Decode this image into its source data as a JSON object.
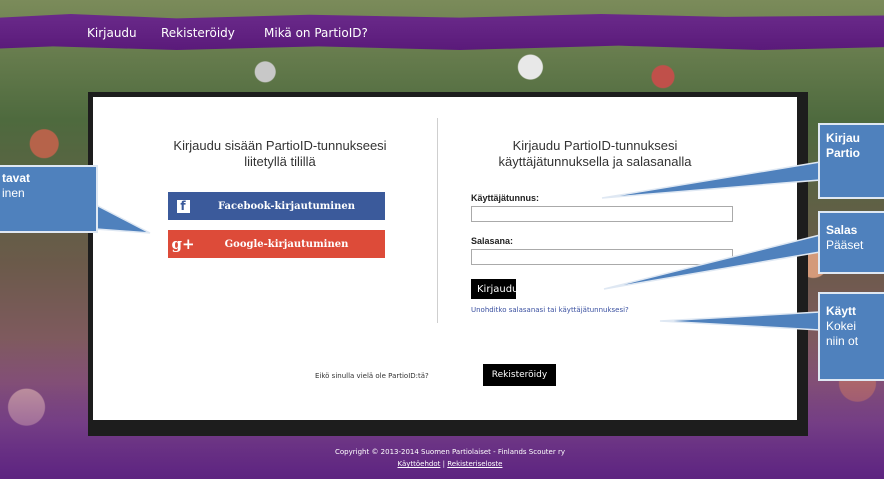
{
  "nav": {
    "items": [
      "Kirjaudu",
      "Rekisteröidy",
      "Mikä on PartioID?"
    ]
  },
  "left": {
    "title_line1": "Kirjaudu sisään PartioID-tunnukseesi",
    "title_line2": "liitetyllä tilillä",
    "facebook_label": "Facebook-kirjautuminen",
    "facebook_icon": "f",
    "google_label": "Google-kirjautuminen",
    "google_icon": "g+"
  },
  "right": {
    "title_line1": "Kirjaudu PartioID-tunnuksesi",
    "title_line2": "käyttäjätunnuksella ja salasanalla",
    "username_label": "Käyttäjätunnus:",
    "username_value": "",
    "password_label": "Salasana:",
    "password_value": "",
    "login_button": "Kirjaudu",
    "forgot_link": "Unohditko salasanasi tai käyttäjätunnuksesi?"
  },
  "register": {
    "prompt": "Eikö sinulla vielä ole PartioID:tä?",
    "button": "Rekisteröidy"
  },
  "footer": {
    "copyright": "Copyright © 2013-2014 Suomen Partiolaiset - Finlands Scouter ry",
    "terms_link": "Käyttöehdot",
    "separator": "|",
    "privacy_link": "Rekisteriseloste"
  },
  "callouts": {
    "left_line1": "tavat",
    "left_line2": "inen",
    "right1_line1": "Kirjau",
    "right1_line2": "Partio",
    "right2_line1": "Salas",
    "right2_line2": "Pääset",
    "right3_line1": "Käytt",
    "right3_line2": "Kokei",
    "right3_line3": "niin ot"
  },
  "colors": {
    "nav_purple": "#5a1a7a",
    "facebook_blue": "#3b5a9b",
    "google_red": "#dd4b39",
    "callout_blue": "#4f81bd",
    "link_blue": "#3a50a0"
  }
}
